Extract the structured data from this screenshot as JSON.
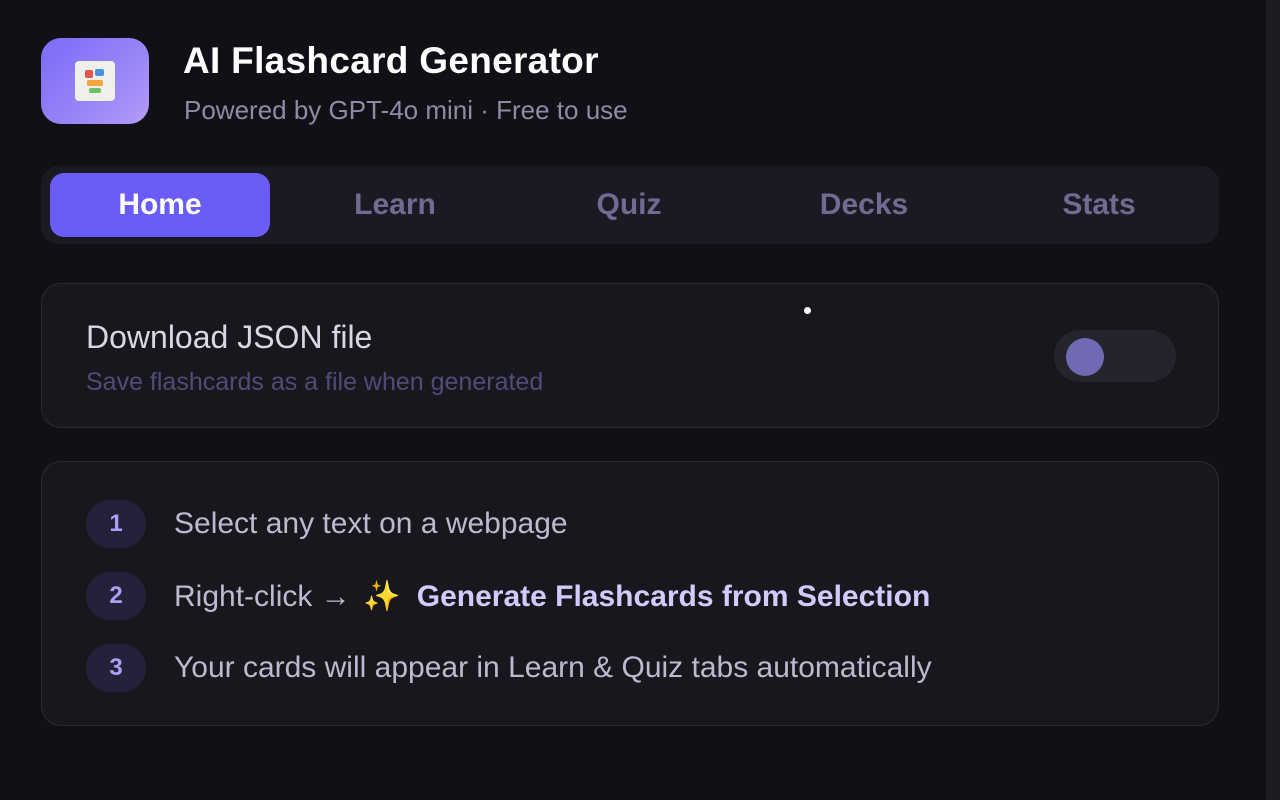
{
  "header": {
    "title": "AI Flashcard Generator",
    "subtitle": "Powered by GPT-4o mini · Free to use",
    "icon": "flashcard-app-icon"
  },
  "tabs": [
    {
      "label": "Home",
      "active": true
    },
    {
      "label": "Learn",
      "active": false
    },
    {
      "label": "Quiz",
      "active": false
    },
    {
      "label": "Decks",
      "active": false
    },
    {
      "label": "Stats",
      "active": false
    }
  ],
  "download_option": {
    "title": "Download JSON file",
    "description": "Save flashcards as a file when generated",
    "enabled": false
  },
  "steps": [
    {
      "number": "1",
      "text": "Select any text on a webpage"
    },
    {
      "number": "2",
      "prefix": "Right-click →",
      "emoji": "✨",
      "action": "Generate Flashcards from Selection"
    },
    {
      "number": "3",
      "text": "Your cards will appear in Learn & Quiz tabs automatically"
    }
  ],
  "colors": {
    "accent": "#6a5cf6",
    "background": "#111016",
    "card": "#18171e"
  }
}
